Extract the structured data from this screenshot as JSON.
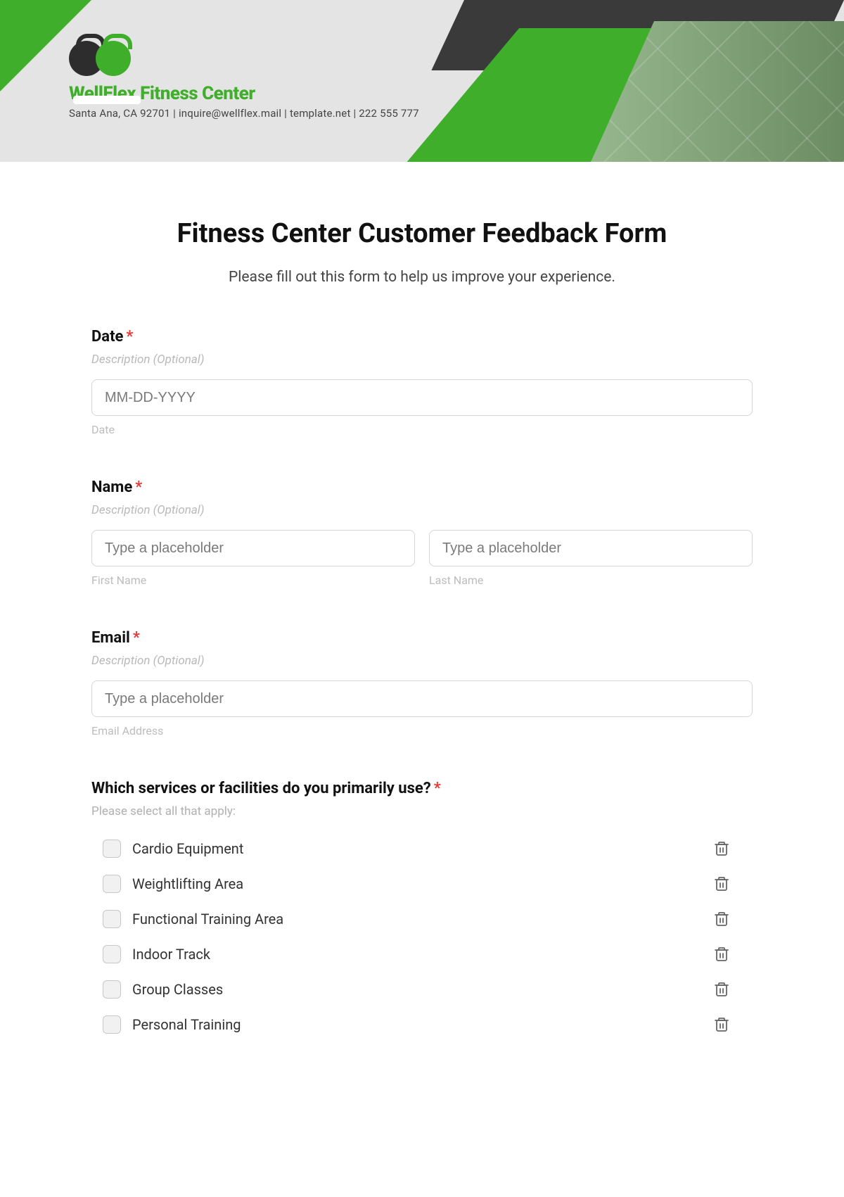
{
  "header": {
    "brand": "WellFlex Fitness Center",
    "contact": "Santa Ana, CA 92701 | inquire@wellflex.mail | template.net | 222 555 777"
  },
  "form": {
    "title": "Fitness Center Customer Feedback Form",
    "intro": "Please fill out this form to help us improve your experience.",
    "required_mark": "*",
    "desc_placeholder": "Description (Optional)",
    "date": {
      "label": "Date",
      "placeholder": "MM-DD-YYYY",
      "sub": "Date"
    },
    "name": {
      "label": "Name",
      "placeholder": "Type a placeholder",
      "first_sub": "First Name",
      "last_sub": "Last Name"
    },
    "email": {
      "label": "Email",
      "placeholder": "Type a placeholder",
      "sub": "Email Address"
    },
    "services": {
      "label": "Which services or facilities do you primarily use?",
      "hint": "Please select all that apply:",
      "options": [
        "Cardio Equipment",
        "Weightlifting Area",
        "Functional Training Area",
        "Indoor Track",
        "Group Classes",
        "Personal Training"
      ]
    }
  }
}
